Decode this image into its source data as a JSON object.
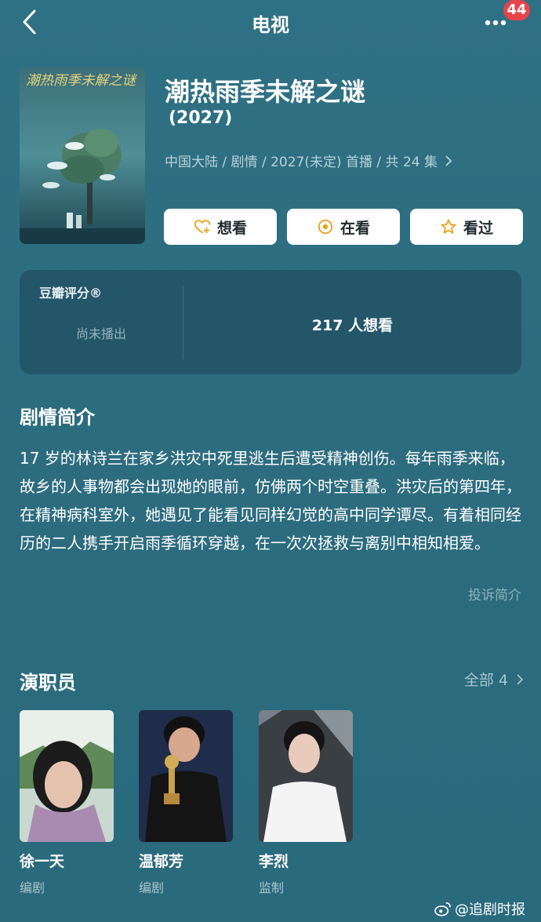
{
  "nav": {
    "title": "电视",
    "badge": "44"
  },
  "show": {
    "title": "潮热雨季未解之谜",
    "year": "(2027)",
    "meta": "中国大陆 / 剧情 / 2027(未定) 首播 / 共 24 集",
    "poster_title_art": "潮热雨季未解之谜"
  },
  "actions": {
    "want": "想看",
    "watching": "在看",
    "watched": "看过"
  },
  "rating": {
    "label": "豆瓣评分®",
    "status": "尚未播出",
    "want_count": "217 人想看"
  },
  "synopsis": {
    "title": "剧情简介",
    "text": "17 岁的林诗兰在家乡洪灾中死里逃生后遭受精神创伤。每年雨季来临，故乡的人事物都会出现她的眼前，仿佛两个时空重叠。洪灾后的第四年，在精神病科室外，她遇见了能看见同样幻觉的高中同学谭尽。有着相同经历的二人携手开启雨季循环穿越，在一次次拯救与离别中相知相爱。",
    "report": "投诉简介"
  },
  "cast": {
    "title": "演职员",
    "all_label": "全部 4",
    "members": [
      {
        "name": "徐一天",
        "role": "编剧"
      },
      {
        "name": "温郁芳",
        "role": "编剧"
      },
      {
        "name": "李烈",
        "role": "监制"
      }
    ]
  },
  "watermark": "@追剧时报",
  "icons": {
    "back": "chevron-left-icon",
    "more": "more-dots-icon",
    "want": "heart-plus-icon",
    "watching": "target-icon",
    "watched": "star-icon",
    "chevron": "chevron-right-icon",
    "weibo": "weibo-icon"
  },
  "colors": {
    "background": "#2e6d80",
    "panel": "#24566a",
    "badge": "#e8434b",
    "accent": "#f0a020"
  }
}
